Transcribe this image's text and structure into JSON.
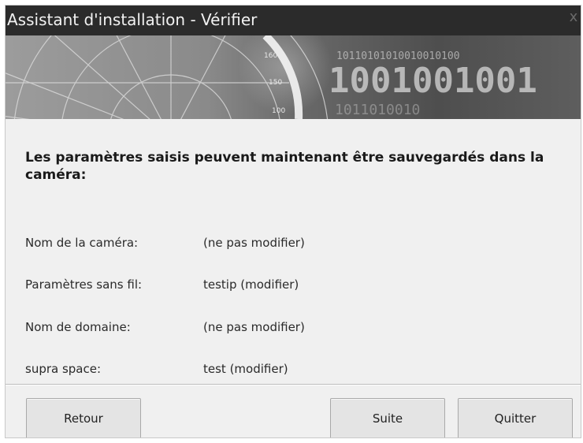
{
  "window": {
    "title": "Assistant d'installation - Vérifier",
    "close_glyph": "x"
  },
  "banner": {
    "binary_text_1": "10110101010010010100",
    "binary_text_2": "1001001001",
    "binary_text_3": "1011010010",
    "dial_marks": [
      "160",
      "150",
      "100"
    ]
  },
  "main": {
    "heading": "Les paramètres saisis peuvent maintenant être sauvegardés dans la caméra:",
    "rows": [
      {
        "label": "Nom de la caméra:",
        "value": "(ne pas modifier)"
      },
      {
        "label": "Paramètres sans fil:",
        "value": "testip (modifier)"
      },
      {
        "label": "Nom de domaine:",
        "value": "(ne pas modifier)"
      },
      {
        "label": "supra space:",
        "value": "test (modifier)"
      }
    ]
  },
  "buttons": {
    "back_label": "Retour",
    "next_label": "Suite",
    "quit_label": "Quitter"
  }
}
